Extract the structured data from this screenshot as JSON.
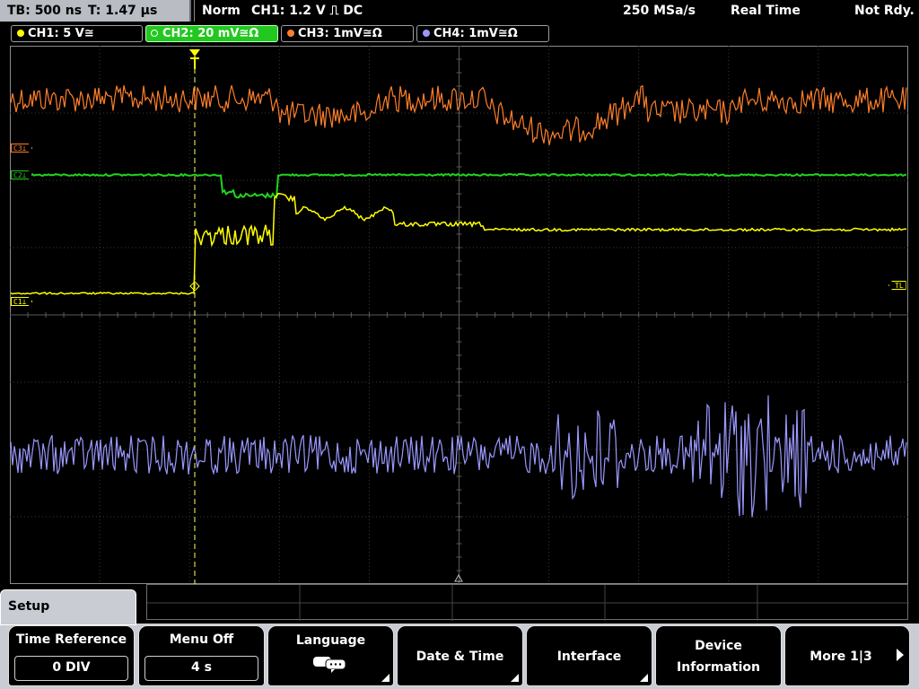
{
  "status": {
    "timebase": "TB: 500 ns",
    "trigger_time": "T: 1.47 µs",
    "mode": "Norm",
    "trigger_info": "CH1: 1.2 V ⎍ DC",
    "sample_rate": "250 MSa/s",
    "acq_mode": "Real Time",
    "state": "Not Rdy."
  },
  "channels": [
    {
      "label": "CH1: 5 V≅",
      "color": "#ffff00",
      "active": false
    },
    {
      "label": "CH2: 20 mV≅Ω",
      "color": "#22c81f",
      "active": true
    },
    {
      "label": "CH3: 1mV≅Ω",
      "color": "#ff7f2a",
      "active": false
    },
    {
      "label": "CH4: 1mV≅Ω",
      "color": "#9a98ff",
      "active": false
    }
  ],
  "markers": {
    "c3": "C3⊥",
    "c2": "C2⊥",
    "c1": "C1⊥",
    "trigger_level": "TL"
  },
  "softkeys": {
    "setup_tab": "Setup",
    "time_reference": {
      "label": "Time Reference",
      "value": "0 DIV"
    },
    "menu_off": {
      "label": "Menu Off",
      "value": "4 s"
    },
    "language": {
      "label": "Language",
      "icon": "speech-bubble-icon"
    },
    "date_time": "Date & Time",
    "interface": "Interface",
    "device_info": {
      "line1": "Device",
      "line2": "Information"
    },
    "more": "More 1|3"
  }
}
